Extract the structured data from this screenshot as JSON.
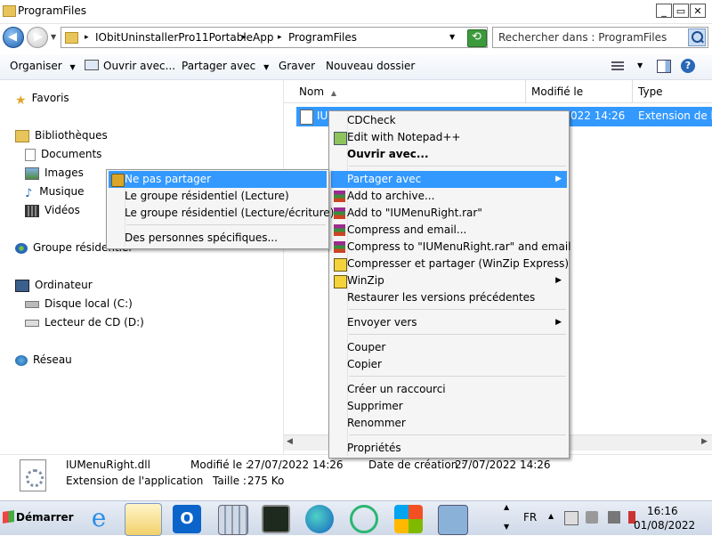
{
  "window": {
    "title": "ProgramFiles",
    "btn_min": "_",
    "btn_max": "▭",
    "btn_close": "✕"
  },
  "address": {
    "crumbs": [
      "IObitUninstallerPro11Portable",
      "App",
      "ProgramFiles"
    ],
    "sep": "▸"
  },
  "search": {
    "placeholder": "Rechercher dans : ProgramFiles",
    "icon": "search-icon"
  },
  "toolbar": {
    "organiser": "Organiser",
    "ouvrir_avec": "Ouvrir avec...",
    "partager_avec": "Partager avec",
    "graver": "Graver",
    "nouveau_dossier": "Nouveau dossier",
    "dropdown": "▼"
  },
  "nav": {
    "favoris": "Favoris",
    "bibliotheques": "Bibliothèques",
    "documents": "Documents",
    "images": "Images",
    "musique": "Musique",
    "videos": "Vidéos",
    "groupe": "Groupe résidentiel",
    "ordinateur": "Ordinateur",
    "disque": "Disque local (C:)",
    "cd": "Lecteur de CD (D:)",
    "reseau": "Réseau"
  },
  "columns": {
    "nom": "Nom",
    "modifie": "Modifié le",
    "type": "Type",
    "sort": "▲"
  },
  "file": {
    "name_part": "IU",
    "date_part": "022 14:26",
    "type": "Extension de l'ap"
  },
  "details": {
    "filename": "IUMenuRight.dll",
    "type": "Extension de l'application",
    "modified_label": "Modifié le :",
    "modified": "27/07/2022 14:26",
    "created_label": "Date de création :",
    "created": "27/07/2022 14:26",
    "size_label": "Taille :",
    "size": "275 Ko"
  },
  "context_menu": {
    "items": [
      "CDCheck",
      "Edit with Notepad++",
      "Ouvrir avec...",
      "Partager avec",
      "Add to archive...",
      "Add to \"IUMenuRight.rar\"",
      "Compress and email...",
      "Compress to \"IUMenuRight.rar\" and email",
      "Compresser et partager (WinZip Express)",
      "WinZip",
      "Restaurer les versions précédentes",
      "Envoyer vers",
      "Couper",
      "Copier",
      "Créer un raccourci",
      "Supprimer",
      "Renommer",
      "Propriétés"
    ],
    "submenu_arrow": "▶"
  },
  "share_menu": {
    "items": [
      "Ne pas partager",
      "Le groupe résidentiel (Lecture)",
      "Le groupe résidentiel (Lecture/écriture)",
      "Des personnes spécifiques..."
    ]
  },
  "taskbar": {
    "start": "Démarrer",
    "lang": "FR",
    "time": "16:16",
    "date": "01/08/2022",
    "tray_up": "▲",
    "scroll_up": "▲",
    "scroll_down": "▼"
  },
  "colors": {
    "selection": "#3399ff",
    "menu_bg": "#f5f5f5"
  }
}
